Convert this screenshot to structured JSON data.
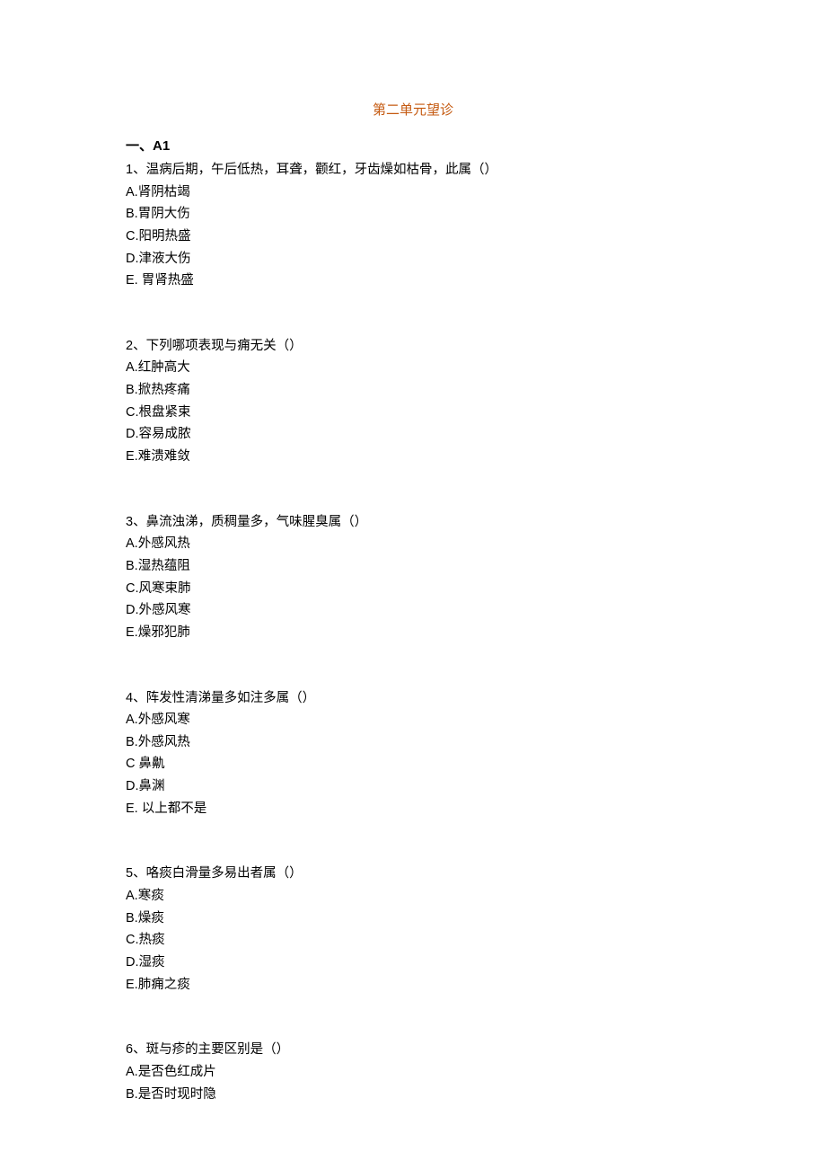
{
  "title": "第二单元望诊",
  "section_header": "一、A1",
  "questions": [
    {
      "text": "1、温病后期，午后低热，耳聋，颧红，牙齿燥如枯骨，此属（）",
      "options": [
        "A.肾阴枯竭",
        "B.胃阴大伤",
        "C.阳明热盛",
        "D.津液大伤",
        "E. 胃肾热盛"
      ]
    },
    {
      "text": "2、下列哪项表现与痈无关（）",
      "options": [
        "A.红肿高大",
        "B.掀热疼痛",
        "C.根盘紧束",
        "D.容易成脓",
        "E.难溃难敛"
      ]
    },
    {
      "text": "3、鼻流浊涕，质稠量多，气味腥臭属（）",
      "options": [
        "A.外感风热",
        "B.湿热蕴阻",
        "C.风寒束肺",
        "D.外感风寒",
        "E.燥邪犯肺"
      ]
    },
    {
      "text": "4、阵发性清涕量多如注多属（）",
      "options": [
        "A.外感风寒",
        "B.外感风热",
        "C 鼻鼽",
        "D.鼻渊",
        "E. 以上都不是"
      ]
    },
    {
      "text": "5、咯痰白滑量多易出者属（）",
      "options": [
        "A.寒痰",
        "B.燥痰",
        "C.热痰",
        "D.湿痰",
        "E.肺痈之痰"
      ]
    },
    {
      "text": "6、斑与疹的主要区别是（）",
      "options": [
        "A.是否色红成片",
        "B.是否时现时隐"
      ]
    }
  ]
}
